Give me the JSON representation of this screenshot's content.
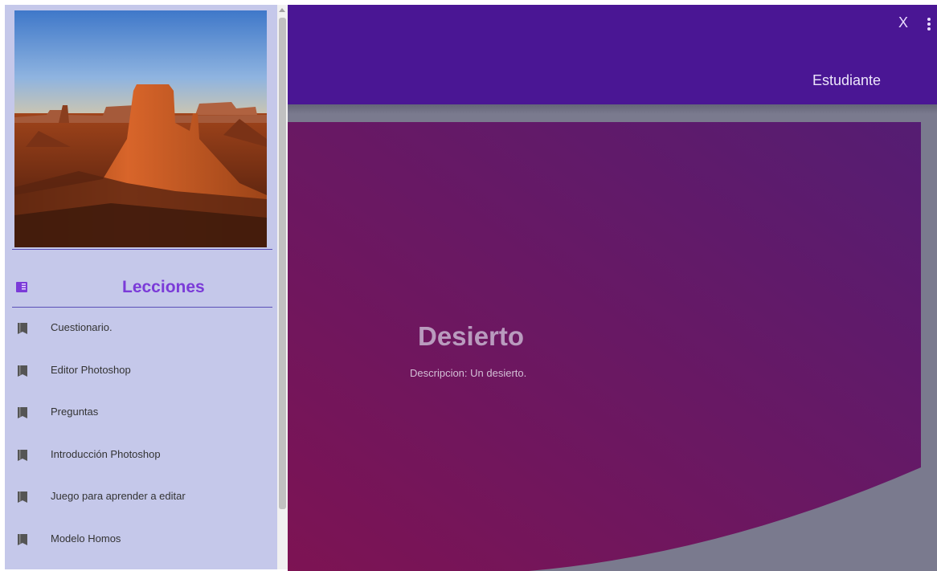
{
  "sidebar": {
    "section_title": "Lecciones",
    "lessons": [
      {
        "label": "Cuestionario."
      },
      {
        "label": "Editor Photoshop"
      },
      {
        "label": "Preguntas"
      },
      {
        "label": "Introducción Photoshop"
      },
      {
        "label": "Juego para aprender a editar"
      },
      {
        "label": "Modelo Homos"
      }
    ],
    "icons": {
      "section": "book-open-icon",
      "lesson": "book-icon"
    }
  },
  "header": {
    "close_label": "X",
    "role_label": "Estudiante",
    "background": "#4a1694"
  },
  "card": {
    "title": "Desierto",
    "description": "Descripcion: Un desierto.",
    "gradient": [
      "#7d1353",
      "#551d73"
    ]
  },
  "colors": {
    "sidebar_bg": "#c5c8ea",
    "accent": "#7b3bd8",
    "content_bg": "#7a7a8e"
  }
}
